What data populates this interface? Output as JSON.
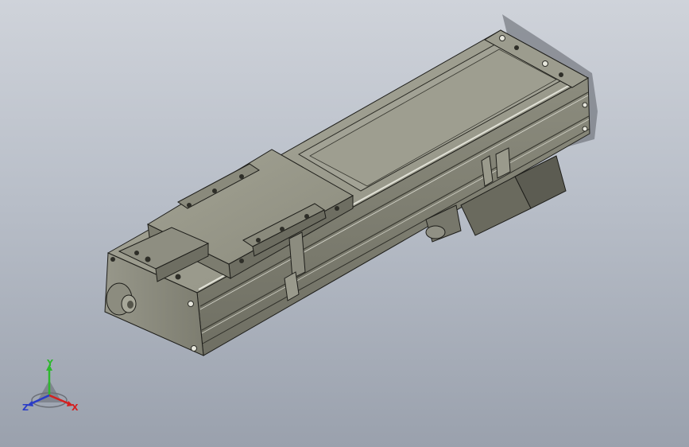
{
  "viewport": {
    "background_top": "#cfd3da",
    "background_bottom": "#9aa1ad"
  },
  "model": {
    "body_color": "#8a8a7c",
    "edge_color": "#1e1e1a",
    "carriage_color": "#7f7f70",
    "motor_color": "#5c5c52"
  },
  "triad": {
    "x_label": "X",
    "y_label": "Y",
    "z_label": "Z",
    "x_color": "#d42020",
    "y_color": "#2eb82e",
    "z_color": "#2a3cc8"
  }
}
